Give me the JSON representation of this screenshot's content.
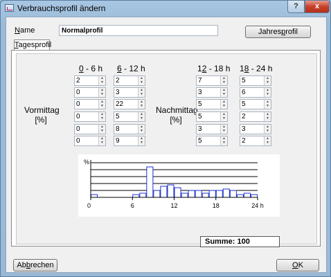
{
  "window": {
    "title": "Verbrauchsprofil ändern",
    "help_glyph": "?",
    "close_glyph": "x"
  },
  "name_field": {
    "label_accel": "N",
    "label_rest": "ame",
    "value": "Normalprofil"
  },
  "buttons": {
    "jahres_pre": "Jahres",
    "jahres_accel": "p",
    "jahres_post": "rofil",
    "abbrechen_pre": "Ab",
    "abbrechen_accel": "b",
    "abbrechen_post": "rechen",
    "ok_pre": "",
    "ok_accel": "O",
    "ok_post": "K"
  },
  "tab": {
    "accel": "T",
    "rest": "agesprofil"
  },
  "vormittag": {
    "label": "Vormittag",
    "unit": "[%]"
  },
  "nachmittag": {
    "label": "Nachmittag",
    "unit": "[%]"
  },
  "columns": [
    {
      "accel": "0",
      "rest": " - 6 h",
      "values": [
        "2",
        "0",
        "0",
        "0",
        "0",
        "0"
      ]
    },
    {
      "accel": "6",
      "rest": " - 12 h",
      "values": [
        "2",
        "3",
        "22",
        "5",
        "8",
        "9"
      ]
    },
    {
      "pre": "1",
      "accel": "2",
      "rest": " - 18 h",
      "values": [
        "7",
        "3",
        "5",
        "5",
        "3",
        "5"
      ]
    },
    {
      "pre": "1",
      "accel": "8",
      "rest": " - 24 h",
      "values": [
        "5",
        "6",
        "5",
        "2",
        "3",
        "2"
      ]
    }
  ],
  "chart_data": {
    "type": "bar",
    "ylabel": "%",
    "xticks": [
      "0",
      "6",
      "12",
      "18",
      "24 h"
    ],
    "xlim": [
      0,
      24
    ],
    "values": [
      2,
      0,
      0,
      0,
      0,
      0,
      2,
      3,
      22,
      5,
      8,
      9,
      7,
      3,
      5,
      5,
      3,
      5,
      5,
      6,
      5,
      2,
      3,
      2
    ],
    "grid": true
  },
  "summe": "Summe: 100"
}
